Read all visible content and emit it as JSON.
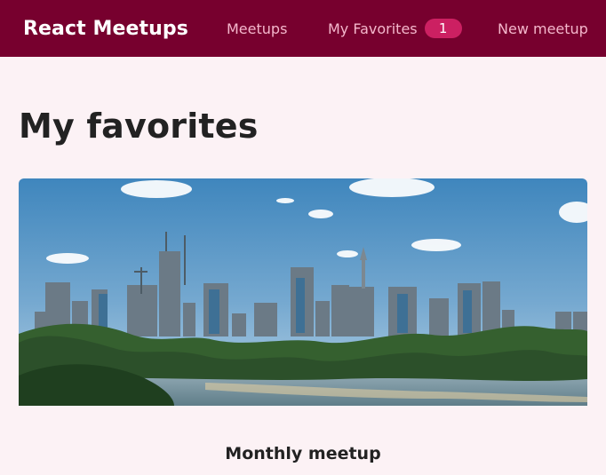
{
  "header": {
    "logo": "React Meetups",
    "nav": {
      "meetups_label": "Meetups",
      "favorites_label": "My Favorites",
      "favorites_count": "1",
      "new_meetup_label": "New meetup"
    }
  },
  "main": {
    "title": "My favorites",
    "favorites": [
      {
        "title": "Monthly meetup",
        "image_alt": "City skyline across a river"
      }
    ]
  },
  "colors": {
    "header_bg": "#77002e",
    "page_bg": "#fcf2f5",
    "badge_bg": "#cc2062",
    "nav_text": "#f4b7cc"
  }
}
